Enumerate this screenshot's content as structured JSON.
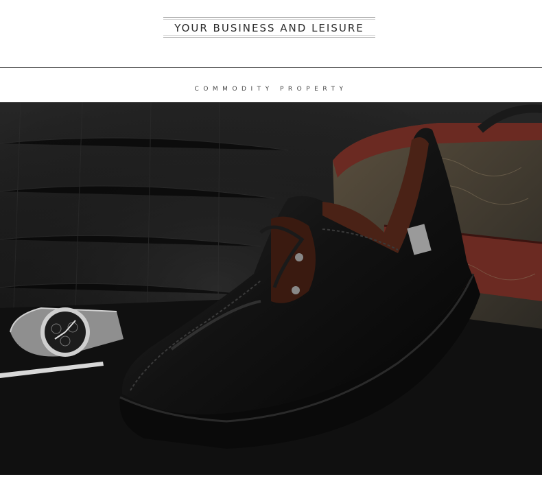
{
  "header": {
    "title": "YOUR BUSINESS AND LEISURE"
  },
  "section": {
    "subtitle": "COMMODITY PROPERTY"
  },
  "photo": {
    "subject": "black-leather-shoe-product-photo",
    "props": [
      "wristwatch",
      "pen",
      "vintage-box"
    ],
    "colors": {
      "background": "#151515",
      "shoe": "#0e0e0e",
      "collar": "#4a2216",
      "box": "#6b2a22"
    }
  }
}
